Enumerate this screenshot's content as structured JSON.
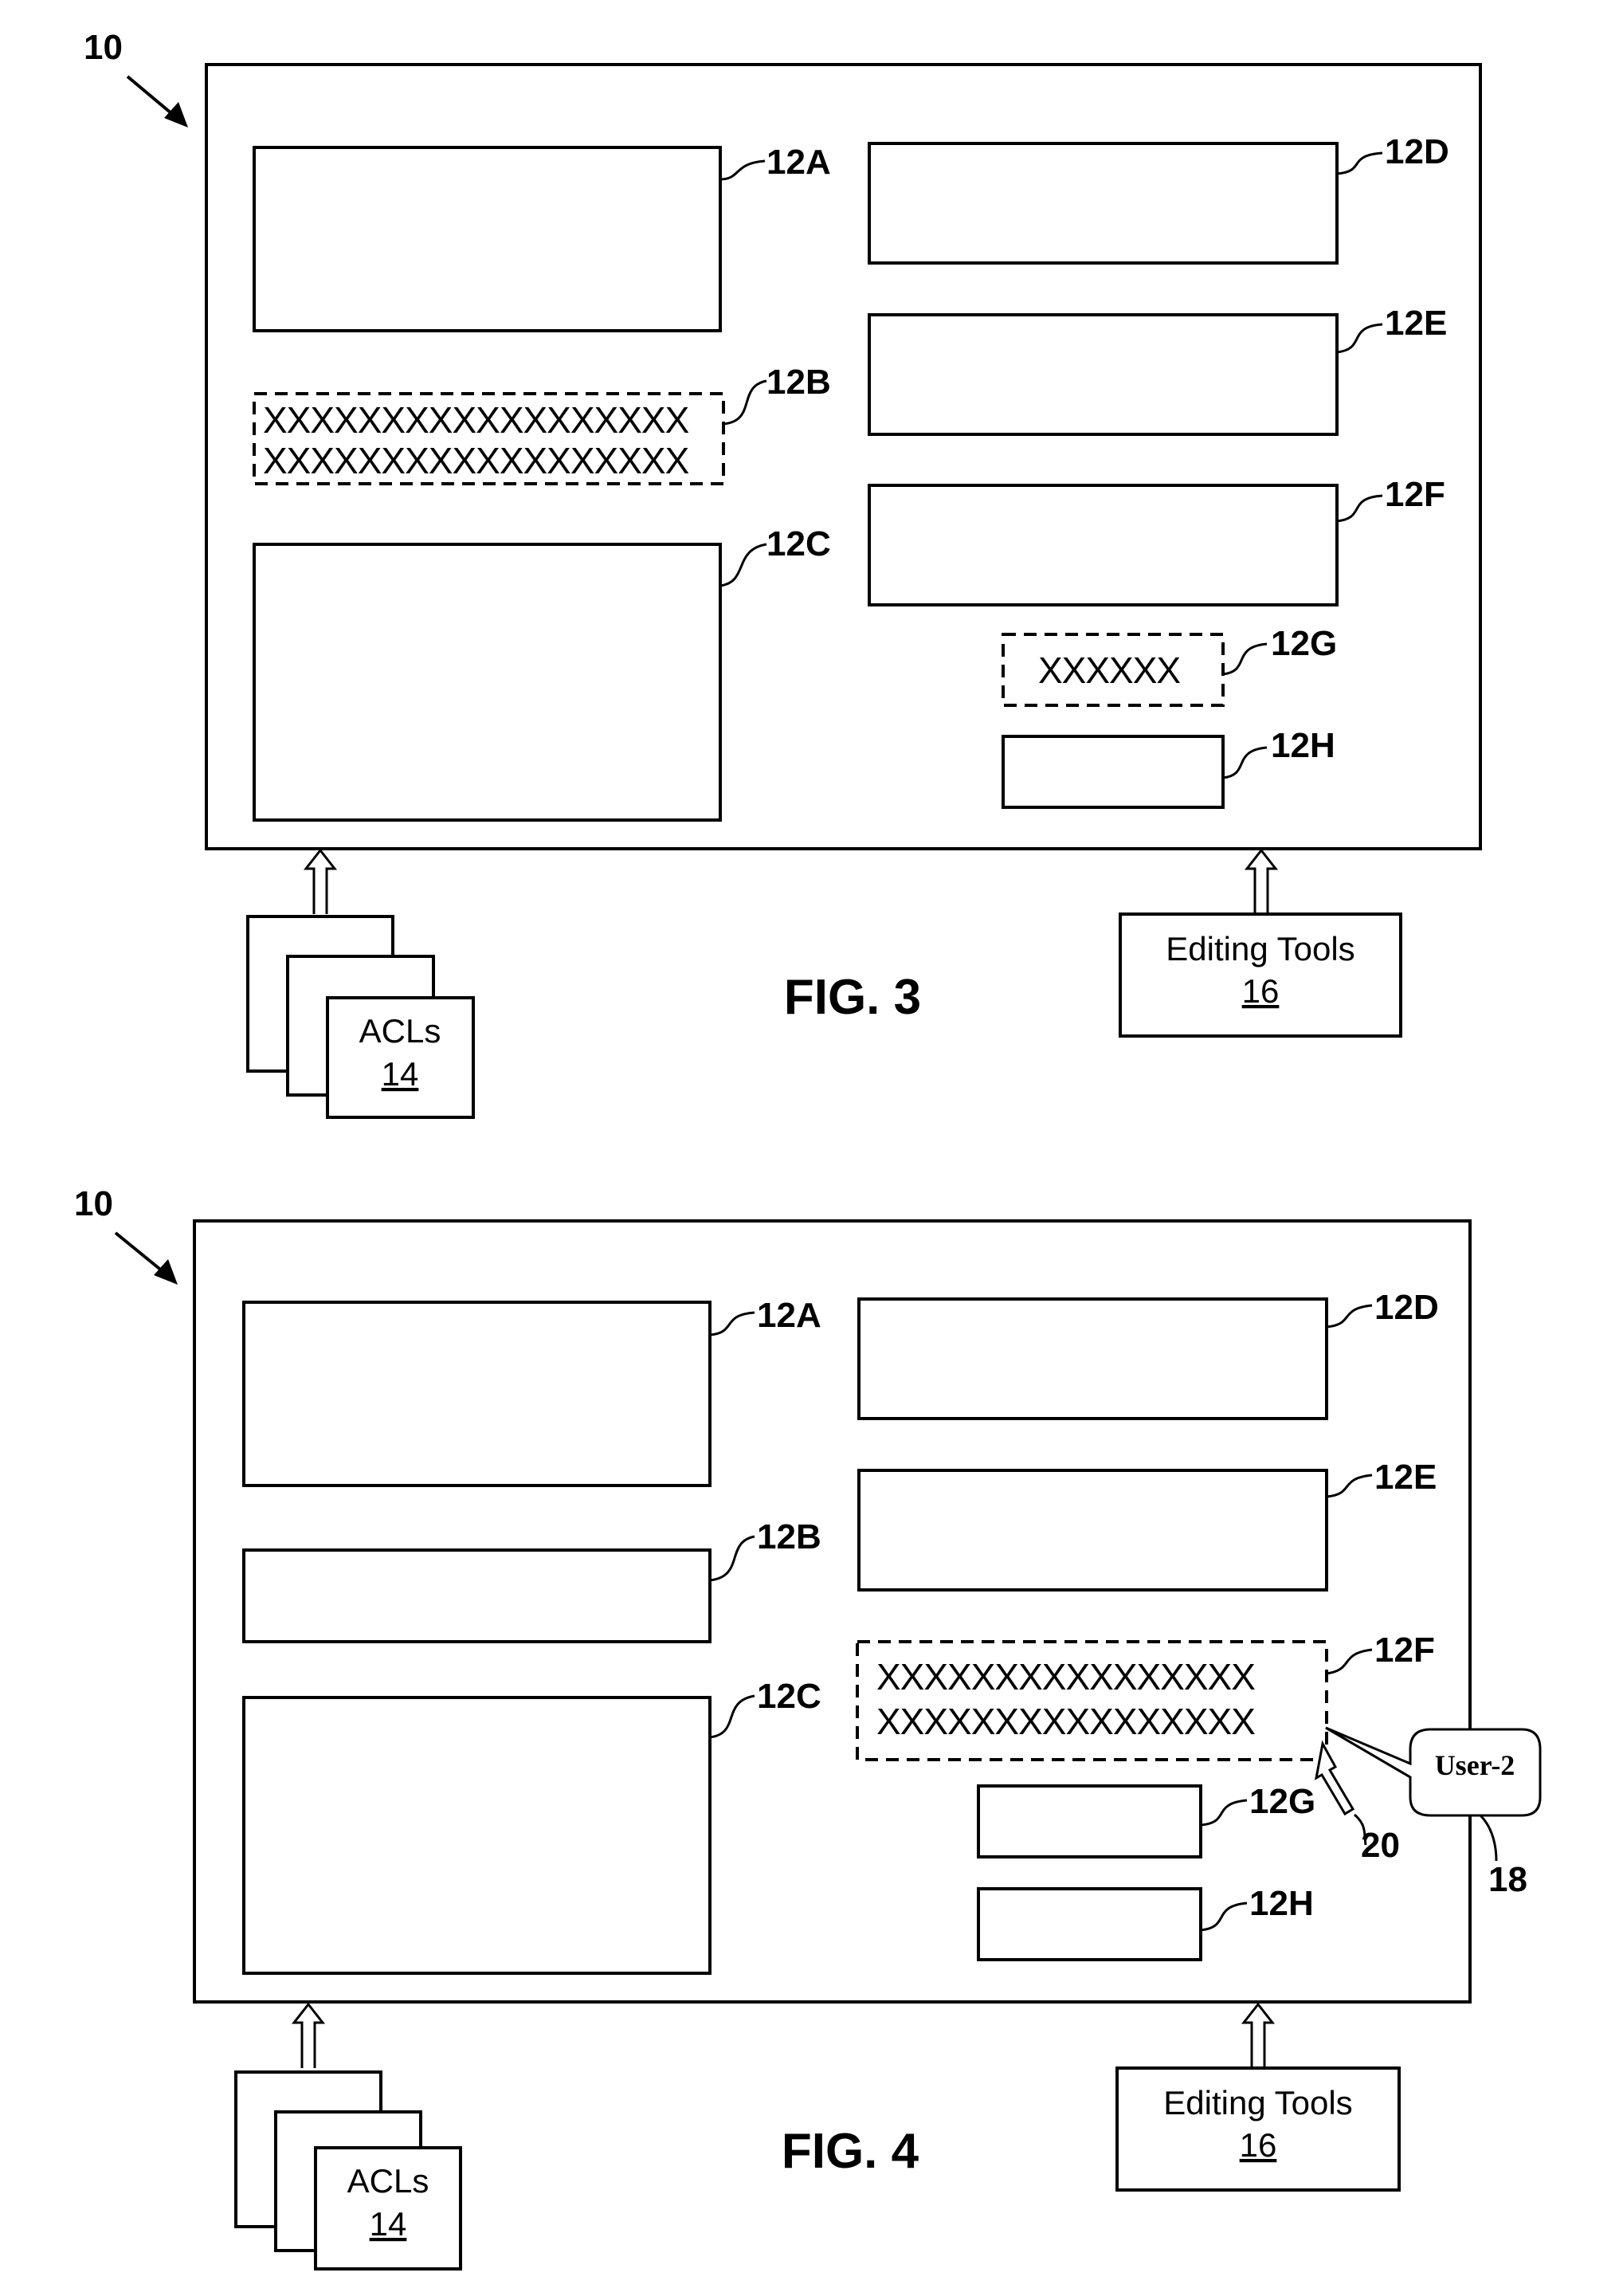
{
  "figures": [
    {
      "caption": "FIG. 3",
      "document_ref": "10",
      "regions": [
        {
          "id": "12A",
          "label": "12A",
          "locked": false,
          "content": []
        },
        {
          "id": "12B",
          "label": "12B",
          "locked": true,
          "content": [
            "XXXXXXXXXXXXXXXXXX",
            "XXXXXXXXXXXXXXXXXX"
          ]
        },
        {
          "id": "12C",
          "label": "12C",
          "locked": false,
          "content": []
        },
        {
          "id": "12D",
          "label": "12D",
          "locked": false,
          "content": []
        },
        {
          "id": "12E",
          "label": "12E",
          "locked": false,
          "content": []
        },
        {
          "id": "12F",
          "label": "12F",
          "locked": false,
          "content": []
        },
        {
          "id": "12G",
          "label": "12G",
          "locked": true,
          "content": [
            "XXXXXX"
          ]
        },
        {
          "id": "12H",
          "label": "12H",
          "locked": false,
          "content": []
        }
      ],
      "acls": {
        "title": "ACLs",
        "ref": "14"
      },
      "editing_tools": {
        "title": "Editing Tools",
        "ref": "16"
      }
    },
    {
      "caption": "FIG. 4",
      "document_ref": "10",
      "regions": [
        {
          "id": "12A",
          "label": "12A",
          "locked": false,
          "content": []
        },
        {
          "id": "12B",
          "label": "12B",
          "locked": false,
          "content": []
        },
        {
          "id": "12C",
          "label": "12C",
          "locked": false,
          "content": []
        },
        {
          "id": "12D",
          "label": "12D",
          "locked": false,
          "content": []
        },
        {
          "id": "12E",
          "label": "12E",
          "locked": false,
          "content": []
        },
        {
          "id": "12F",
          "label": "12F",
          "locked": true,
          "content": [
            "XXXXXXXXXXXXXXXX",
            "XXXXXXXXXXXXXXXX"
          ]
        },
        {
          "id": "12G",
          "label": "12G",
          "locked": false,
          "content": []
        },
        {
          "id": "12H",
          "label": "12H",
          "locked": false,
          "content": []
        }
      ],
      "acls": {
        "title": "ACLs",
        "ref": "14"
      },
      "editing_tools": {
        "title": "Editing Tools",
        "ref": "16"
      },
      "user_indicator": {
        "text": "User-2",
        "ref": "18"
      },
      "cursor": {
        "ref": "20"
      }
    }
  ]
}
